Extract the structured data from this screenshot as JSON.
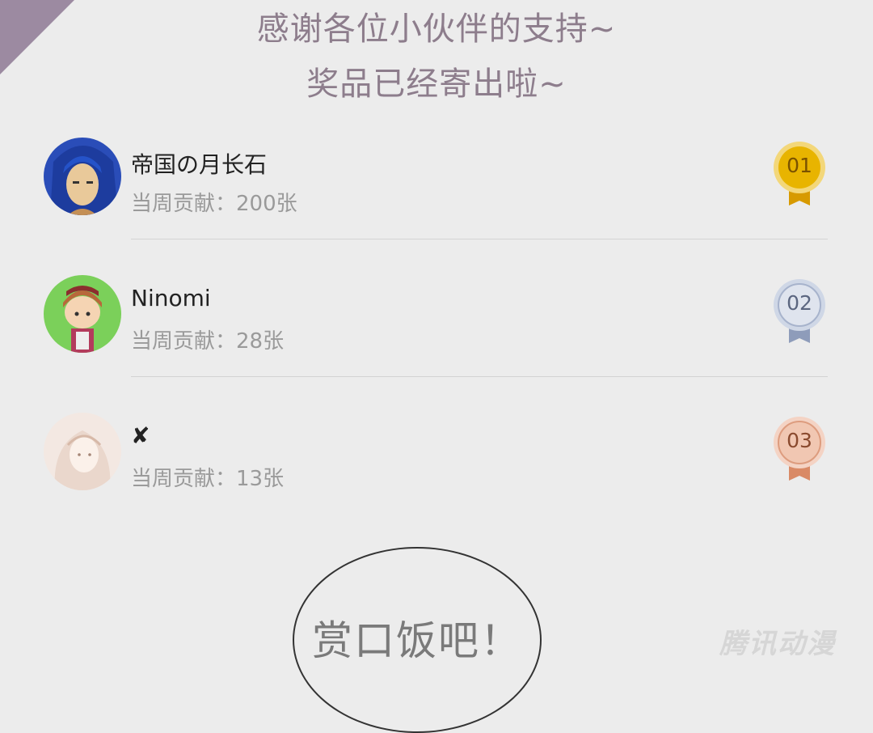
{
  "header": {
    "line1": "感谢各位小伙伴的支持~",
    "line2": "奖品已经寄出啦~"
  },
  "ranking": [
    {
      "name": "帝国の月长石",
      "contribution": "当周贡献：200张",
      "rank": "01",
      "medal": "gold",
      "medal_color": "#e8b400"
    },
    {
      "name": "Ninomi",
      "contribution": "当周贡献：28张",
      "rank": "02",
      "medal": "silver",
      "medal_color": "#aab6cf"
    },
    {
      "name": "✘",
      "contribution": "当周贡献：13张",
      "rank": "03",
      "medal": "bronze",
      "medal_color": "#e0a083"
    }
  ],
  "bubble": {
    "text": "赏口饭吧！"
  },
  "watermark": {
    "text": "腾讯动漫"
  },
  "colors": {
    "background": "#ececec",
    "title": "#8d7d8c",
    "corner": "#9c8aa1"
  }
}
